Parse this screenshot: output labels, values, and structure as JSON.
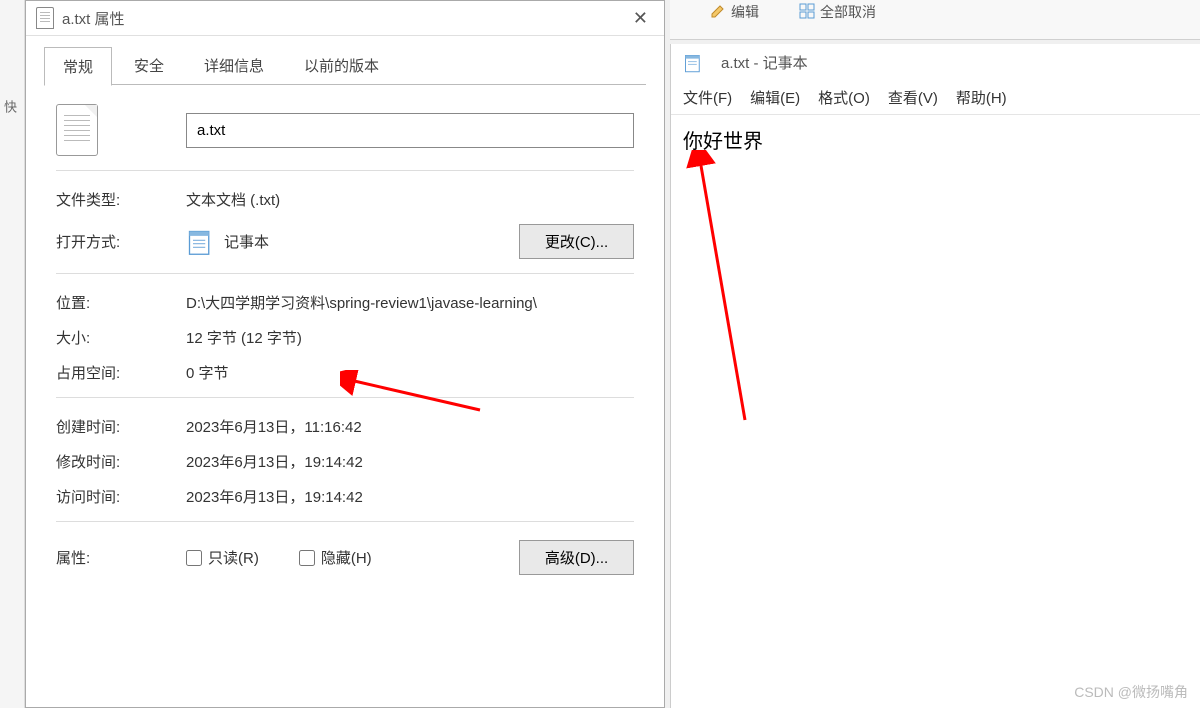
{
  "properties": {
    "title": "a.txt 属性",
    "tabs": [
      "常规",
      "安全",
      "详细信息",
      "以前的版本"
    ],
    "filename": "a.txt",
    "fields": {
      "file_type_label": "文件类型:",
      "file_type_value": "文本文档 (.txt)",
      "open_with_label": "打开方式:",
      "open_with_value": "记事本",
      "change_button": "更改(C)...",
      "location_label": "位置:",
      "location_value": "D:\\大四学期学习资料\\spring-review1\\javase-learning\\",
      "size_label": "大小:",
      "size_value": "12 字节 (12 字节)",
      "disk_label": "占用空间:",
      "disk_value": "0 字节",
      "created_label": "创建时间:",
      "created_value": "2023年6月13日，11:16:42",
      "modified_label": "修改时间:",
      "modified_value": "2023年6月13日，19:14:42",
      "accessed_label": "访问时间:",
      "accessed_value": "2023年6月13日，19:14:42",
      "attributes_label": "属性:",
      "readonly_label": "只读(R)",
      "hidden_label": "隐藏(H)",
      "advanced_button": "高级(D)..."
    }
  },
  "notepad": {
    "title": "a.txt - 记事本",
    "menu": [
      "文件(F)",
      "编辑(E)",
      "格式(O)",
      "查看(V)",
      "帮助(H)"
    ],
    "content": "你好世界"
  },
  "toolbar": {
    "edit": "编辑",
    "deselect": "全部取消"
  },
  "left_fragment": "快",
  "watermark": "CSDN @微扬嘴角"
}
